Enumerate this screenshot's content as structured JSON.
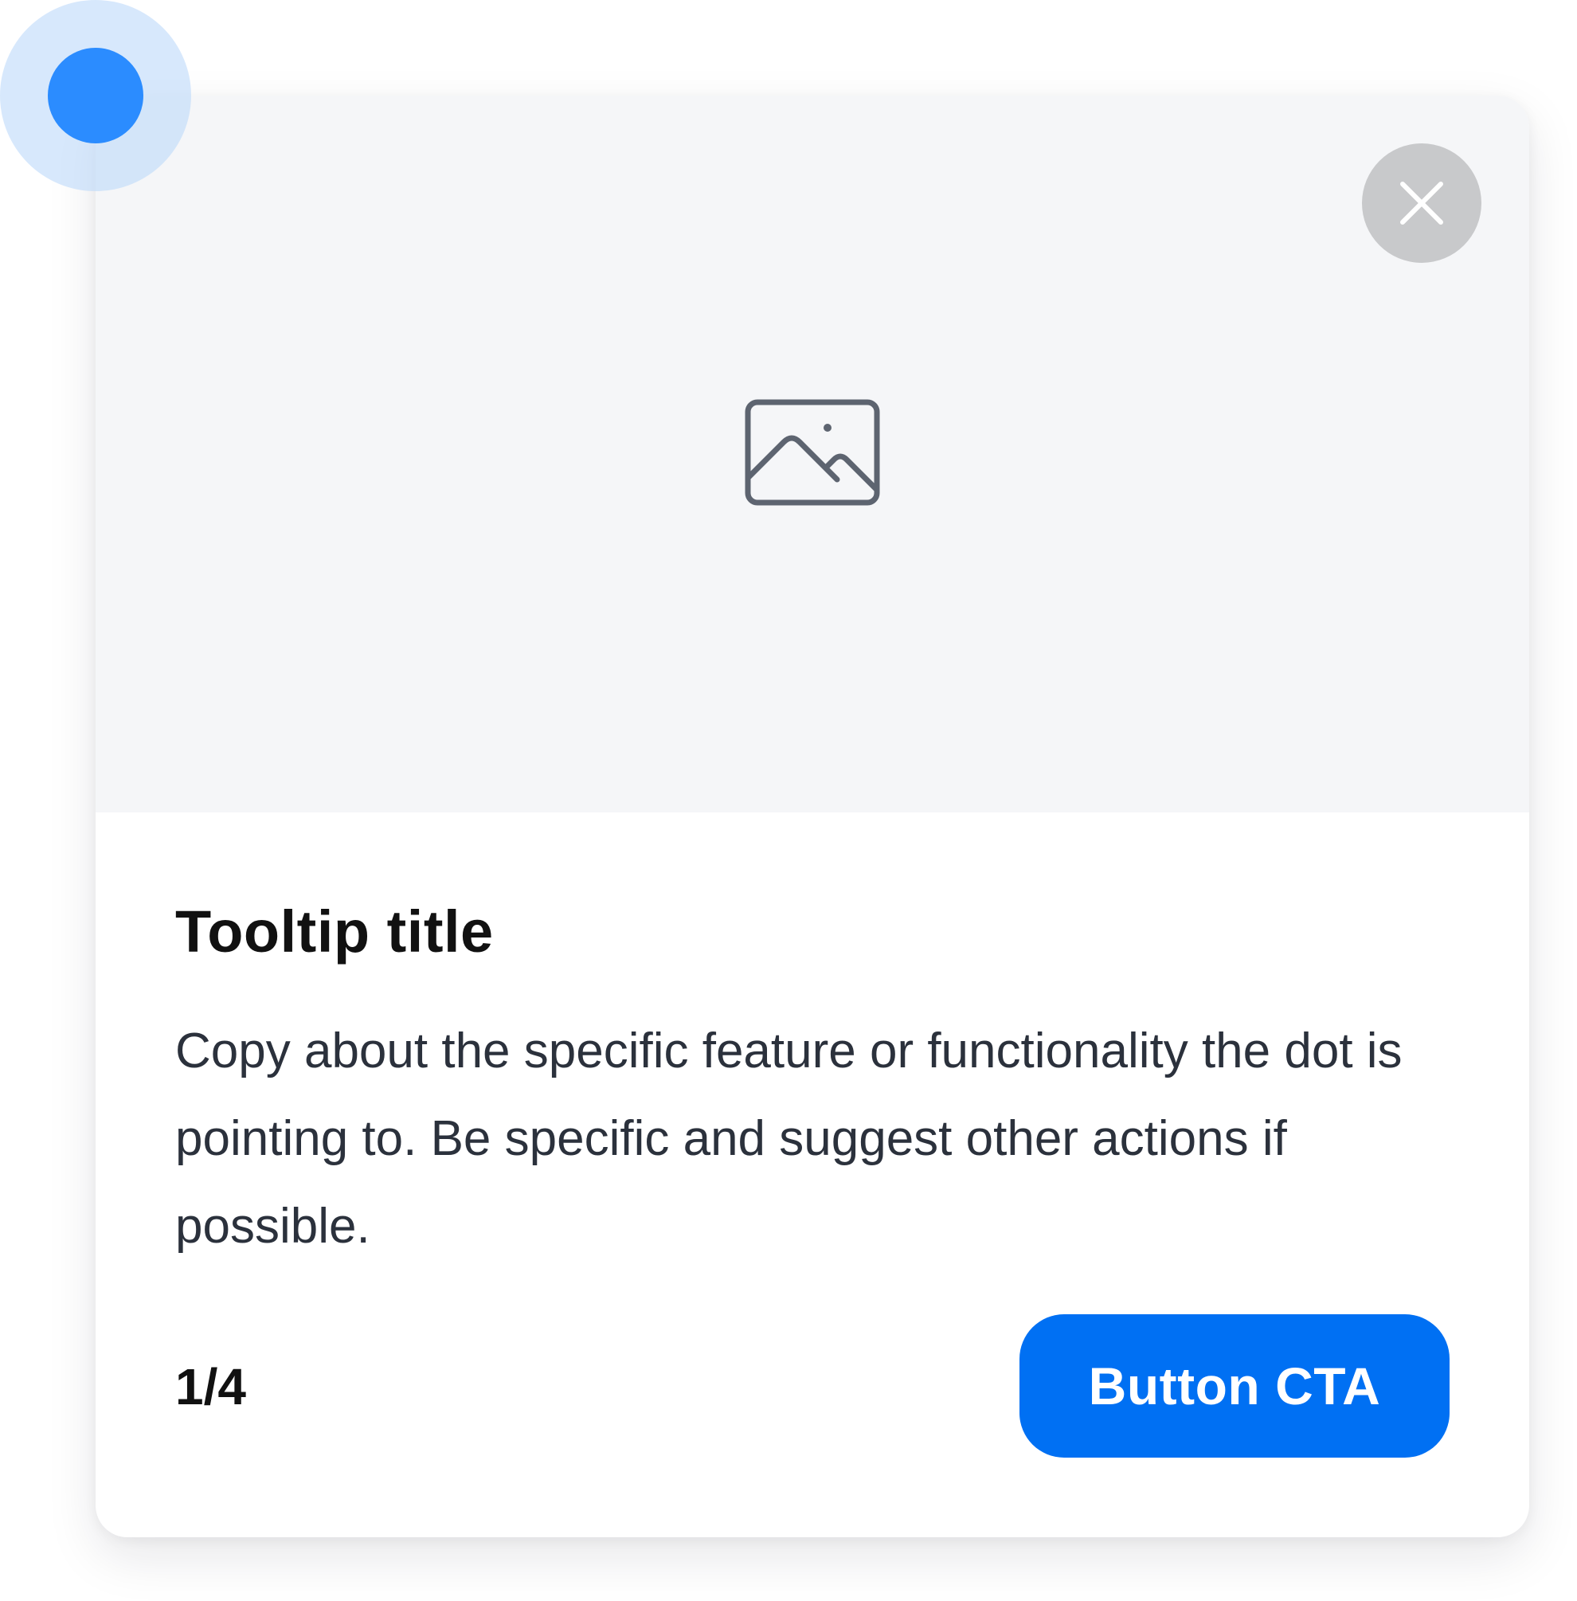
{
  "tooltip": {
    "title": "Tooltip title",
    "body": "Copy about the specific feature or functionality the dot is pointing to. Be specific and suggest other actions if possible.",
    "step_counter": "1/4",
    "cta_label": "Button CTA",
    "close_icon": "close-icon",
    "media_icon": "image-placeholder-icon"
  },
  "beacon": {
    "icon": "hotspot-dot"
  },
  "colors": {
    "accent": "#0070f3",
    "beacon_dot": "#2b8cff",
    "beacon_halo": "#d6e7fc",
    "media_background": "#f5f6f8",
    "close_button_background": "#c8c9cb",
    "title_text": "#111111",
    "body_text": "#2b313c"
  }
}
